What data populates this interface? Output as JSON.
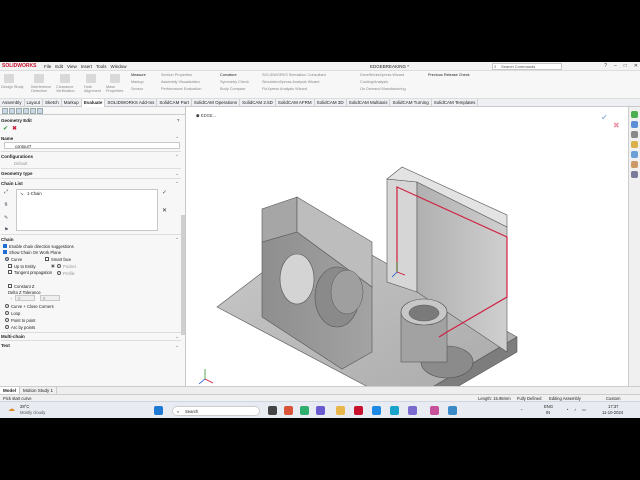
{
  "app": {
    "logo": "SOLIDWORKS",
    "menu": [
      "File",
      "Edit",
      "View",
      "Insert",
      "Tools",
      "Window"
    ],
    "document_title": "EDGEBREAKING *",
    "search_placeholder": "Search Commands",
    "window_controls": [
      "?",
      "–",
      "□",
      "✕"
    ]
  },
  "ribbon": {
    "groups": [
      {
        "label": "Design Study",
        "enabled": false
      },
      {
        "label": "Interference Detection",
        "enabled": false
      },
      {
        "label": "Clearance Verification",
        "enabled": false
      },
      {
        "label": "Hole Alignment",
        "enabled": false
      },
      {
        "label": "Mass Properties",
        "enabled": false
      }
    ],
    "col1": [
      "Measure",
      "Markup",
      "Sensor"
    ],
    "col2": [
      "Section Properties",
      "Assembly Visualization",
      "Performance Evaluation"
    ],
    "col3": [
      "Curvature",
      "Symmetry Check",
      "Body Compare"
    ],
    "col4": [
      "SOLIDWORKS Simulation Consultant",
      "SimulationXpress Analysis Wizard",
      "FloXpress Analysis Wizard"
    ],
    "col5": [
      "DriveWorksXpress Wizard",
      "Costing/Analysis",
      "On Demand Manufacturing"
    ],
    "col6": [
      "Previous Release Check"
    ]
  },
  "command_tabs": [
    {
      "label": "Assembly",
      "active": false
    },
    {
      "label": "Layout",
      "active": false
    },
    {
      "label": "Sketch",
      "active": false
    },
    {
      "label": "Markup",
      "active": false
    },
    {
      "label": "Evaluate",
      "active": true
    },
    {
      "label": "SOLIDWORKS Add-Ins",
      "active": false
    },
    {
      "label": "SolidCAM Part",
      "active": false
    },
    {
      "label": "SolidCAM Operations",
      "active": false
    },
    {
      "label": "SolidCAM 2.5D",
      "active": false
    },
    {
      "label": "SolidCAM AFRM",
      "active": false
    },
    {
      "label": "SolidCAM 3D",
      "active": false
    },
    {
      "label": "SolidCAM Multiaxis",
      "active": false
    },
    {
      "label": "SolidCAM Turning",
      "active": false
    },
    {
      "label": "SolidCAM Templates",
      "active": false
    }
  ],
  "panel": {
    "title": "Geometry Edit",
    "name_label": "Name",
    "name_value": "contour7",
    "configurations_label": "Configurations",
    "configuration_value": "Default",
    "geometry_type_label": "Geometry type",
    "chain_list_label": "Chain List",
    "chain_items": [
      "1-Chain"
    ],
    "chain_label": "Chain",
    "enable_suggestions": "Enable chain direction suggestions",
    "show_chain": "Show Chain On Work Plane",
    "curve": "Curve",
    "smart_face": "Smart face",
    "up_to_entity": "Up to Entity",
    "pocket": "Pocket",
    "tangent_propagation": "Tangent propagation",
    "profile": "Profile",
    "constant_z": "Constant Z",
    "delta_z_label": "Delta Z Tolerance",
    "delta_z_a": "0",
    "delta_z_b": "0",
    "curve_close": "Curve + Close Corners",
    "loop": "Loop",
    "point_to_point": "Point to point",
    "arc_by_points": "Arc by points",
    "multi_chain_label": "Multi-chain",
    "text_label": "Text"
  },
  "viewport": {
    "tree_label": "EDGE...",
    "part_color": "#9a9a9a",
    "chain_color": "#d02040"
  },
  "bottom_tabs": [
    {
      "label": "Model",
      "active": true
    },
    {
      "label": "Motion Study 1",
      "active": false
    }
  ],
  "status": {
    "left": "Pick start curve",
    "length": "Length: 15.95mm",
    "defined": "Fully Defined",
    "mode": "Editing Assembly",
    "units": "Custom"
  },
  "taskbar": {
    "weather_temp": "28°C",
    "weather_desc": "Mostly cloudy",
    "search": "Search",
    "lang": "ENG",
    "region": "IN",
    "time": "17:37",
    "date": "11-10-2024"
  }
}
